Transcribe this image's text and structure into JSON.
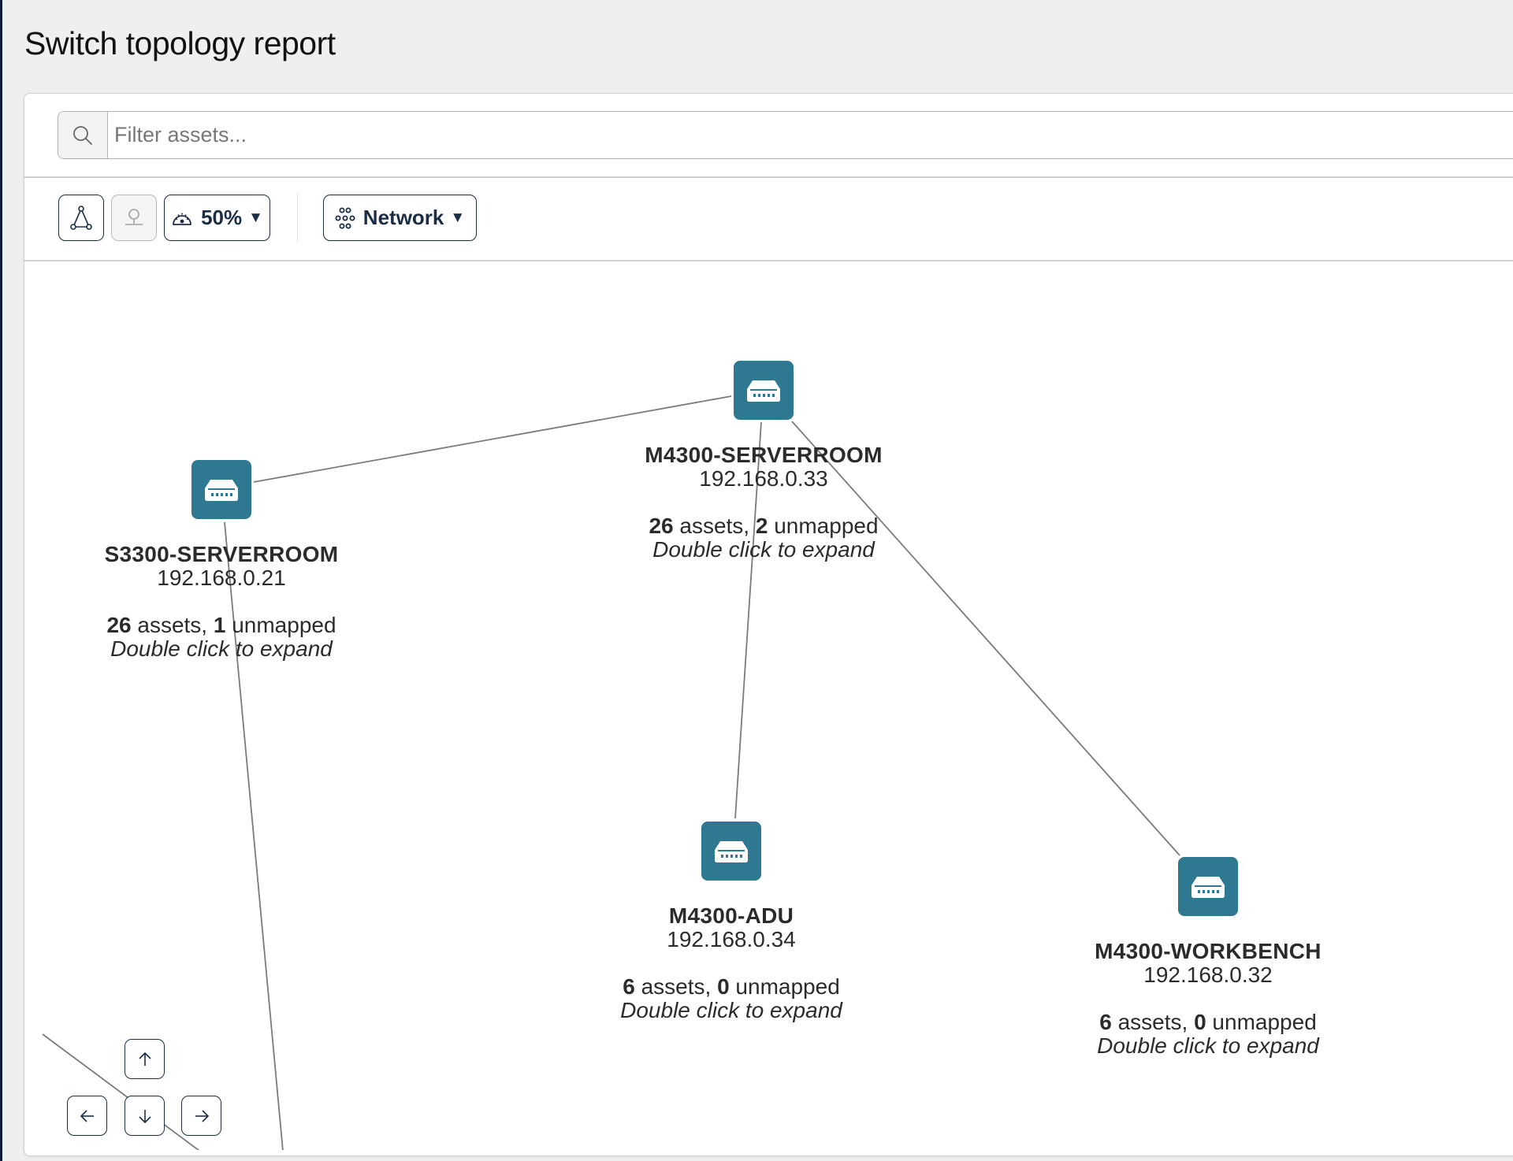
{
  "page": {
    "title": "Switch topology report"
  },
  "search": {
    "placeholder": "Filter assets...",
    "value": "",
    "icon": "search-icon"
  },
  "toolbar": {
    "layout_button": {
      "icon": "graph-layout-icon",
      "disabled": false
    },
    "pin_button": {
      "icon": "pin-icon",
      "disabled": true
    },
    "zoom_select": {
      "icon": "gauge-icon",
      "value": "50%"
    },
    "view_select": {
      "icon": "network-icon",
      "value": "Network"
    },
    "caret": "▼"
  },
  "colors": {
    "node_icon_bg": "#2f7892",
    "text_dark": "#1b2d45",
    "edge": "#777777"
  },
  "topology": {
    "nodes": [
      {
        "id": "m4300-serverroom",
        "name": "M4300-SERVERROOM",
        "ip": "192.168.0.33",
        "assets": "26",
        "assets_label": " assets, ",
        "unmapped": "2",
        "unmapped_label": " unmapped",
        "hint": "Double click to expand"
      },
      {
        "id": "s3300-serverroom",
        "name": "S3300-SERVERROOM",
        "ip": "192.168.0.21",
        "assets": "26",
        "assets_label": " assets, ",
        "unmapped": "1",
        "unmapped_label": " unmapped",
        "hint": "Double click to expand"
      },
      {
        "id": "m4300-adu",
        "name": "M4300-ADU",
        "ip": "192.168.0.34",
        "assets": "6",
        "assets_label": " assets, ",
        "unmapped": "0",
        "unmapped_label": " unmapped",
        "hint": "Double click to expand"
      },
      {
        "id": "m4300-workbench",
        "name": "M4300-WORKBENCH",
        "ip": "192.168.0.32",
        "assets": "6",
        "assets_label": " assets, ",
        "unmapped": "0",
        "unmapped_label": " unmapped",
        "hint": "Double click to expand"
      }
    ],
    "edges": [
      {
        "from": "s3300-serverroom",
        "to": "m4300-serverroom"
      },
      {
        "from": "m4300-serverroom",
        "to": "m4300-adu"
      },
      {
        "from": "m4300-serverroom",
        "to": "m4300-workbench"
      },
      {
        "from": "s3300-serverroom",
        "to": "offscreen-below"
      },
      {
        "from": "offscreen-left",
        "to": "offscreen-below"
      }
    ]
  },
  "navigation": {
    "up": "pan-up",
    "left": "pan-left",
    "down": "pan-down",
    "right": "pan-right"
  }
}
